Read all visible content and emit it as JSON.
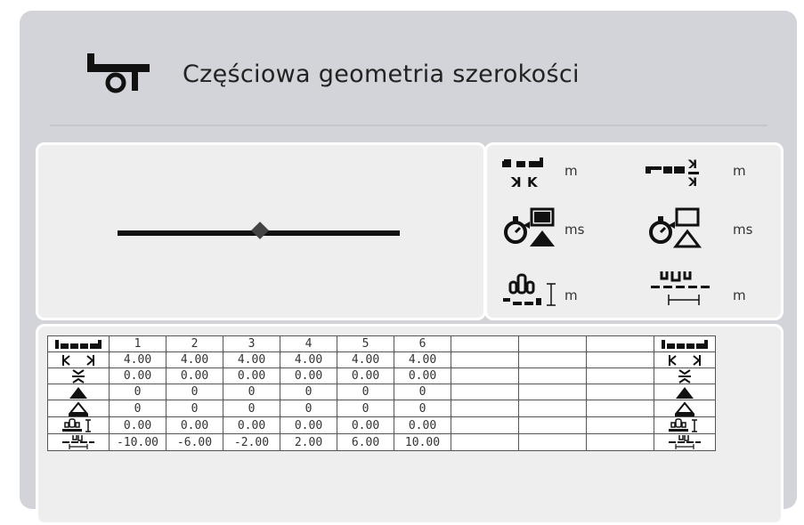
{
  "header": {
    "title": "Częściowa geometria szerokości",
    "icon": "sprayer-tank-icon"
  },
  "params": [
    {
      "icon": "width-overlap-icon",
      "unit": "m"
    },
    {
      "icon": "width-offset-icon",
      "unit": "m"
    },
    {
      "icon": "switch-on-delay-icon",
      "unit": "ms"
    },
    {
      "icon": "switch-off-delay-icon",
      "unit": "ms"
    },
    {
      "icon": "section-offset-y-icon",
      "unit": "m"
    },
    {
      "icon": "section-offset-x-icon",
      "unit": "m"
    }
  ],
  "table": {
    "section_numbers": [
      "1",
      "2",
      "3",
      "4",
      "5",
      "6"
    ],
    "rows": [
      {
        "icon": "width-icon",
        "values": [
          "4.00",
          "4.00",
          "4.00",
          "4.00",
          "4.00",
          "4.00"
        ]
      },
      {
        "icon": "overlap-icon",
        "values": [
          "0.00",
          "0.00",
          "0.00",
          "0.00",
          "0.00",
          "0.00"
        ]
      },
      {
        "icon": "on-delay-icon",
        "values": [
          "0",
          "0",
          "0",
          "0",
          "0",
          "0"
        ]
      },
      {
        "icon": "off-delay-icon",
        "values": [
          "0",
          "0",
          "0",
          "0",
          "0",
          "0"
        ]
      },
      {
        "icon": "offset-y-icon",
        "values": [
          "0.00",
          "0.00",
          "0.00",
          "0.00",
          "0.00",
          "0.00"
        ]
      },
      {
        "icon": "offset-x-icon",
        "values": [
          "-10.00",
          "-6.00",
          "-2.00",
          "2.00",
          "6.00",
          "10.00"
        ]
      }
    ]
  }
}
